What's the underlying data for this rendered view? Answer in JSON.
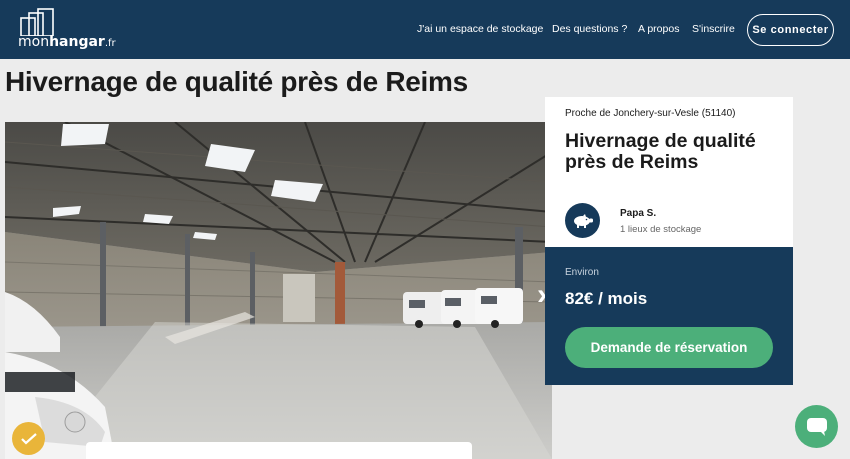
{
  "header": {
    "logo_text_1": "mon",
    "logo_text_2": "hangar",
    "logo_text_3": ".fr",
    "nav": [
      {
        "label": "J'ai un espace de stockage"
      },
      {
        "label": "Des questions ?"
      },
      {
        "label": "A propos"
      },
      {
        "label": "S'inscrire"
      }
    ],
    "login_label": "Se connecter"
  },
  "page": {
    "title": "Hivernage de qualité près de Reims"
  },
  "gallery": {
    "prev_icon": "chevron-left-icon",
    "next_icon": "chevron-right-icon",
    "next_glyph": "›"
  },
  "listing": {
    "location": "Proche de Jonchery-sur-Vesle (51140)",
    "title": "Hivernage de qualité près de Reims",
    "host": {
      "name": "Papa S.",
      "places": "1 lieux de stockage",
      "avatar_icon": "pig-icon"
    },
    "price_label": "Environ",
    "price": "82€ / mois",
    "cta_label": "Demande de réservation"
  },
  "colors": {
    "navy": "#163a5a",
    "green": "#4caf7a",
    "badge": "#e9b53a"
  },
  "widgets": {
    "chat_icon": "chat-icon",
    "badge_icon": "checkmark-badge-icon"
  }
}
